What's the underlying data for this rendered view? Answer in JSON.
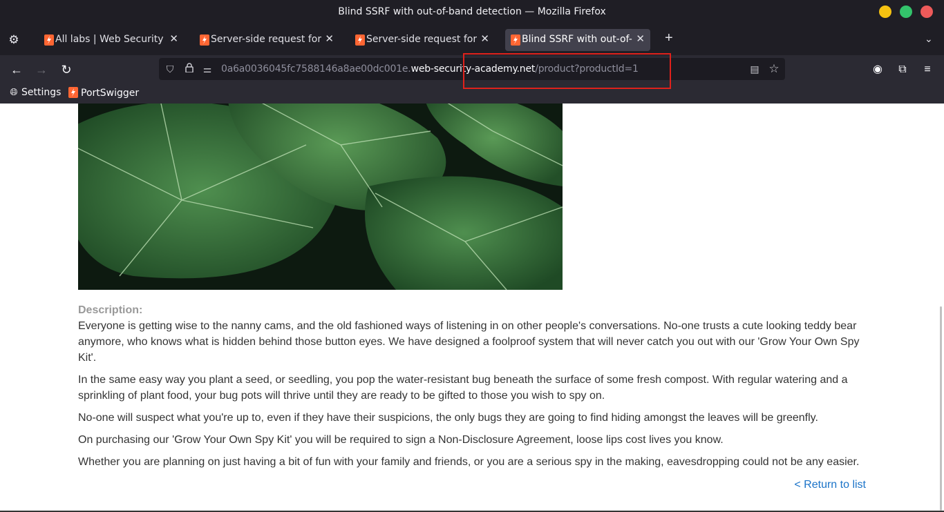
{
  "window": {
    "title": "Blind SSRF with out-of-band detection — Mozilla Firefox"
  },
  "tabs": [
    {
      "label": "All labs | Web Security Academy",
      "active": false
    },
    {
      "label": "Server-side request forgery",
      "active": false
    },
    {
      "label": "Server-side request forgery",
      "active": false
    },
    {
      "label": "Blind SSRF with out-of-band detection",
      "active": true
    }
  ],
  "url": {
    "prefix": "0a6a0036045fc7588146a8ae00dc001e.",
    "host": "web-security-academy.net",
    "path": "/product?productId=1"
  },
  "bookmarks": [
    {
      "label": "Settings",
      "icon": "globe-icon"
    },
    {
      "label": "PortSwigger",
      "icon": "portswigger-icon"
    }
  ],
  "product": {
    "description_label": "Description:",
    "paragraphs": [
      "Everyone is getting wise to the nanny cams, and the old fashioned ways of listening in on other people's conversations. No-one trusts a cute looking teddy bear anymore, who knows what is hidden behind those button eyes. We have designed a foolproof system that will never catch you out with our 'Grow Your Own Spy Kit'.",
      "In the same easy way you plant a seed, or seedling, you pop the water-resistant bug beneath the surface of some fresh compost. With regular watering and a sprinkling of plant food, your bug pots will thrive until they are ready to be gifted to those you wish to spy on.",
      "No-one will suspect what you're up to, even if they have their suspicions, the only bugs they are going to find hiding amongst the leaves will be greenfly.",
      "On purchasing our 'Grow Your Own Spy Kit' you will be required to sign a Non-Disclosure Agreement, loose lips cost lives you know.",
      "Whether you are planning on just having a bit of fun with your family and friends, or you are a serious spy in the making, eavesdropping could not be any easier."
    ],
    "return_link": "< Return to list"
  },
  "colors": {
    "chrome_bg": "#2b2a33",
    "titlebar_bg": "#1f1e25",
    "highlight": "#e0211b",
    "link": "#1a73c8",
    "portswigger_orange": "#ff6633"
  }
}
